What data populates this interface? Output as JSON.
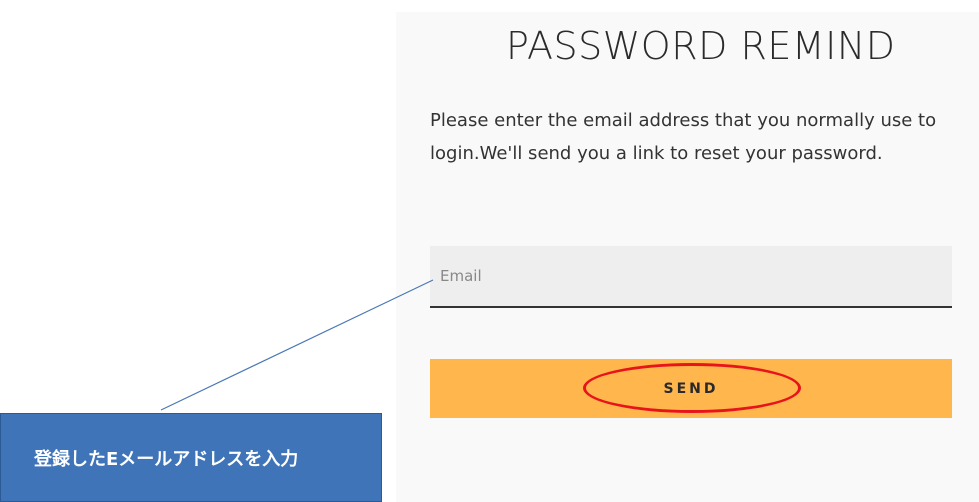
{
  "title": "PASSWORD REMIND",
  "description": "Please enter the email address that you normally use to login.We'll send you a link to reset your password.",
  "email": {
    "placeholder": "Email",
    "value": ""
  },
  "send_button": {
    "label": "SEND"
  },
  "annotation": {
    "text": "登録したEメールアドレスを入力"
  },
  "colors": {
    "panel_bg": "#f9f9f9",
    "input_bg": "#eeeeee",
    "button_bg": "#ffb74d",
    "highlight": "#e8141b",
    "callout_bg": "#3f74b8",
    "callout_line": "#3f74b8"
  }
}
